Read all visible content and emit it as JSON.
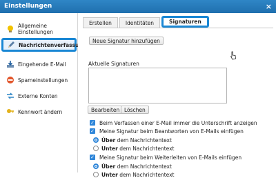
{
  "window": {
    "title": "Einstellungen",
    "close": "×"
  },
  "sidebar": {
    "items": [
      {
        "label": "Allgemeine Einstellungen",
        "line1": "Allgemeine",
        "line2": "Einstellungen",
        "icon": "lightbulb-icon"
      },
      {
        "label": "Nachrichtenverfassung",
        "icon": "pencil-icon",
        "active": true
      },
      {
        "label": "Eingehende E-Mail",
        "icon": "download-arrow-icon"
      },
      {
        "label": "Spameinstellungen",
        "icon": "no-entry-icon"
      },
      {
        "label": "Externe Konten",
        "icon": "arrows-icon"
      },
      {
        "label": "Kennwort ändern",
        "icon": "key-icon"
      }
    ]
  },
  "tabs": [
    {
      "label": "Erstellen"
    },
    {
      "label": "Identitäten"
    },
    {
      "label": "Signaturen",
      "active": true
    }
  ],
  "main": {
    "add_signature_button": "Neue Signatur hinzufügen",
    "current_signatures_label": "Aktuelle Signaturen",
    "edit_button": "Bearbeiten",
    "delete_button": "Löschen",
    "options": {
      "always_signature": "Beim Verfassen einer E-Mail immer die Unterschrift anzeigen",
      "reply_insert": "Meine Signatur beim Beantworten von E-Mails einfügen",
      "reply_above_bold": "Über",
      "reply_above_rest": " dem Nachrichtentext",
      "reply_below_bold": "Unter",
      "reply_below_rest": " dem Nachrichtentext",
      "forward_insert": "Meine Signatur beim Weiterleiten von E-Mails einfügen",
      "forward_above_bold": "Über",
      "forward_above_rest": " dem Nachrichtentext",
      "forward_below_bold": "Unter",
      "forward_below_rest": " dem Nachrichtentext"
    }
  },
  "colors": {
    "accent": "#1a87d4",
    "titlebar": "#2f86c6",
    "checkbox": "#2f86d9"
  }
}
